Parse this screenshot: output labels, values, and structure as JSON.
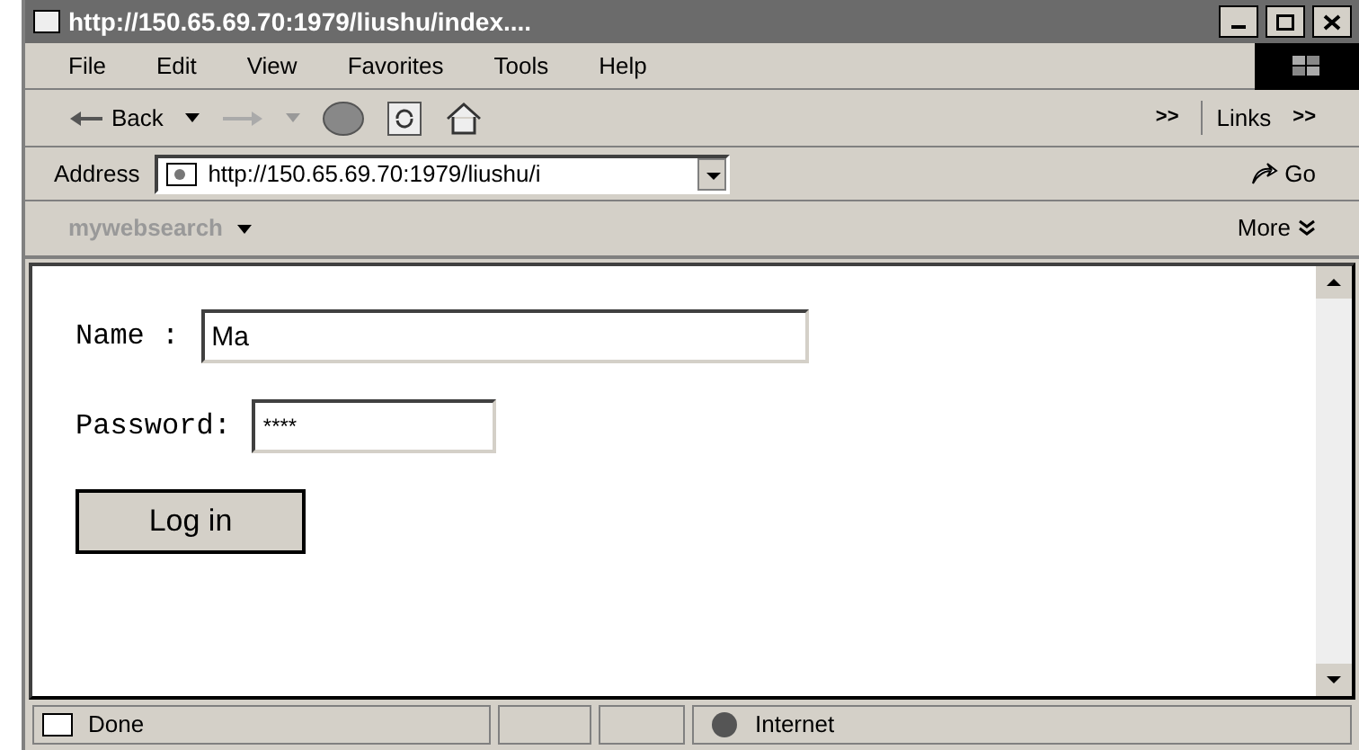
{
  "window": {
    "title": "http://150.65.69.70:1979/liushu/index...."
  },
  "menu": [
    "File",
    "Edit",
    "View",
    "Favorites",
    "Tools",
    "Help"
  ],
  "toolbar": {
    "back": "Back",
    "chevron": ">>",
    "links": "Links",
    "links_chevron": ">>"
  },
  "address": {
    "label": "Address",
    "value": "http://150.65.69.70:1979/liushu/i",
    "go": "Go"
  },
  "search_bar": {
    "brand": "mywebsearch",
    "more": "More"
  },
  "form": {
    "name_label": "Name :",
    "name_value": "Ma",
    "password_label": "Password:",
    "password_value": "****",
    "button": "Log in"
  },
  "status_bar": {
    "text": "Done",
    "zone": "Internet"
  }
}
